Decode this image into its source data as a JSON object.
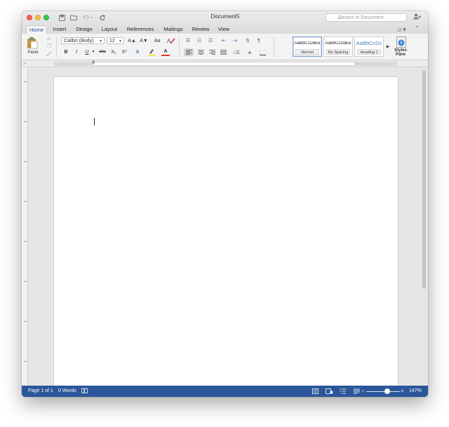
{
  "window": {
    "title": "Document5",
    "search_placeholder": "Search in Document"
  },
  "quick_access": [
    {
      "name": "save-icon",
      "glyph": "▣"
    },
    {
      "name": "open-folder-icon",
      "glyph": "▰"
    },
    {
      "name": "undo-icon",
      "glyph": "↶"
    },
    {
      "name": "redo-icon",
      "glyph": "↻"
    }
  ],
  "tabs": [
    "Home",
    "Insert",
    "Design",
    "Layout",
    "References",
    "Mailings",
    "Review",
    "View"
  ],
  "active_tab": "Home",
  "ribbon": {
    "paste_label": "Paste",
    "font_name": "Calibri (Body)",
    "font_size": "12",
    "grow_font": "A▲",
    "shrink_font": "A▼",
    "change_case": "Aa",
    "bold": "B",
    "italic": "I",
    "underline": "U",
    "strikethrough": "abc",
    "subscript": "X₂",
    "superscript": "X²",
    "text_effects": "A",
    "highlight": "✎",
    "font_color": "A",
    "styles": [
      {
        "sample": "AaBbCcDdEe",
        "label": "Normal",
        "selected": true
      },
      {
        "sample": "AaBbCcDdEe",
        "label": "No Spacing",
        "selected": false
      },
      {
        "sample": "AaBbCcDc",
        "label": "Heading 1",
        "selected": false
      }
    ],
    "styles_pane_label": "Styles Pane"
  },
  "status": {
    "page": "Page 1 of 1",
    "words": "0 Words",
    "zoom": "147%"
  },
  "colors": {
    "accent": "#2b579a",
    "tab_active_text": "#2b579a",
    "heading_style": "#4a7ebb"
  }
}
